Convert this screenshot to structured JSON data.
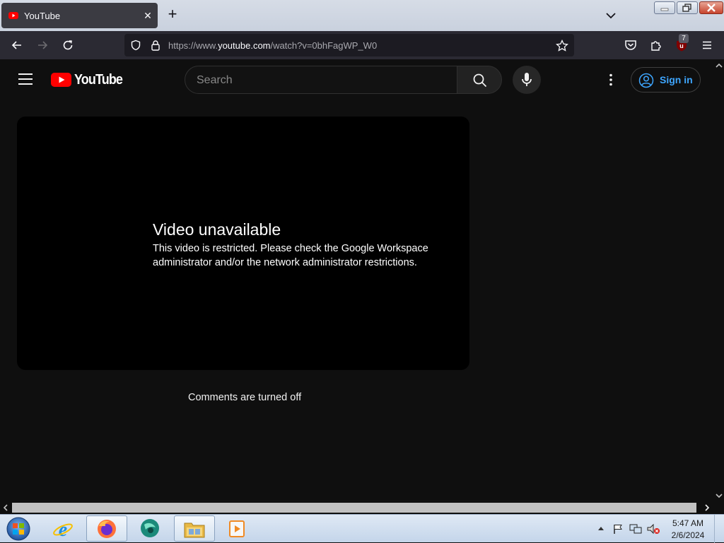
{
  "browser": {
    "tab_title": "YouTube",
    "url_prefix": "https://www.",
    "url_host": "youtube.com",
    "url_path": "/watch?v=0bhFagWP_W0",
    "extension_badge": "7"
  },
  "header": {
    "logo_text": "YouTube",
    "search_placeholder": "Search",
    "sign_in_label": "Sign in"
  },
  "player": {
    "error_title": "Video unavailable",
    "error_message": "This video is restricted. Please check the Google Workspace administrator and/or the network administrator restrictions."
  },
  "comments_status": "Comments are turned off",
  "taskbar": {
    "time": "5:47 AM",
    "date": "2/6/2024"
  },
  "colors": {
    "page_bg": "#0f0f0f",
    "yt_red": "#ff0000",
    "sign_in_blue": "#3ea6ff"
  },
  "icons": [
    "youtube-favicon",
    "close-icon",
    "plus-icon",
    "chevron-down-icon",
    "back-arrow-icon",
    "forward-arrow-icon",
    "reload-icon",
    "shield-icon",
    "lock-icon",
    "star-icon",
    "pocket-icon",
    "extensions-icon",
    "ublock-icon",
    "menu-icon",
    "hamburger-icon",
    "search-icon",
    "mic-icon",
    "kebab-icon",
    "account-icon",
    "windows-start-icon",
    "ie-icon",
    "firefox-icon",
    "file-explorer-icon",
    "media-player-icon"
  ]
}
